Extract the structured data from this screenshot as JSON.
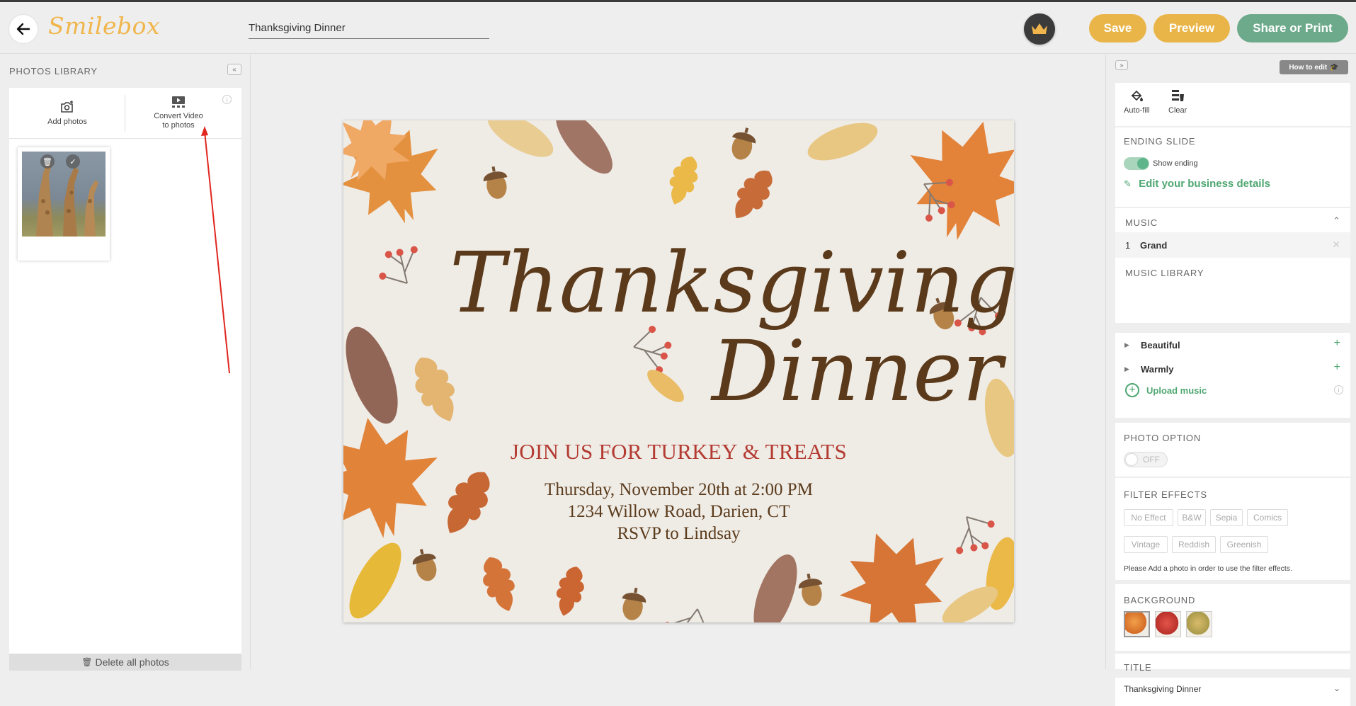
{
  "header": {
    "logo": "Smilebox",
    "title_value": "Thanksgiving Dinner",
    "save_label": "Save",
    "preview_label": "Preview",
    "share_label": "Share or Print"
  },
  "left_panel": {
    "title": "PHOTOS LIBRARY",
    "add_photos_label": "Add photos",
    "convert_video_line1": "Convert Video",
    "convert_video_line2": "to photos",
    "delete_all_label": "Delete all photos"
  },
  "card": {
    "script_line1": "Thanksgiving",
    "script_line2": "Dinner",
    "join": "JOIN US FOR TURKEY & TREATS",
    "date": "Thursday, November 20th at 2:00 PM",
    "address": "1234 Willow Road, Darien, CT",
    "rsvp": "RSVP to Lindsay"
  },
  "right_panel": {
    "how_to_edit": "How to edit",
    "autofill_label": "Auto-fill",
    "clear_label": "Clear",
    "ending_slide": {
      "heading": "ENDING SLIDE",
      "show_ending_label": "Show ending",
      "show_ending_on": true,
      "edit_business_label": "Edit your business details"
    },
    "music": {
      "heading": "MUSIC",
      "selected": [
        {
          "index": "1",
          "name": "Grand"
        }
      ]
    },
    "music_library": {
      "heading": "MUSIC LIBRARY",
      "items": [
        {
          "name": "Beautiful"
        },
        {
          "name": "Warmly"
        }
      ],
      "upload_label": "Upload music"
    },
    "photo_option": {
      "heading": "PHOTO OPTION",
      "toggle_label": "OFF"
    },
    "filter_effects": {
      "heading": "FILTER EFFECTS",
      "options": [
        "No Effect",
        "B&W",
        "Sepia",
        "Comics",
        "Vintage",
        "Reddish",
        "Greenish"
      ],
      "note": "Please Add a photo in order to use the filter effects."
    },
    "background": {
      "heading": "BACKGROUND",
      "swatches": [
        "orange-leaves",
        "red-leaves",
        "gold-leaves"
      ]
    },
    "title_section": {
      "heading": "TITLE",
      "value": "Thanksgiving Dinner"
    }
  },
  "colors": {
    "accent_yellow": "#eab548",
    "share_green": "#6daa8b",
    "link_green": "#4fa772",
    "card_red": "#b33b32",
    "card_brown": "#5b3c1d"
  }
}
